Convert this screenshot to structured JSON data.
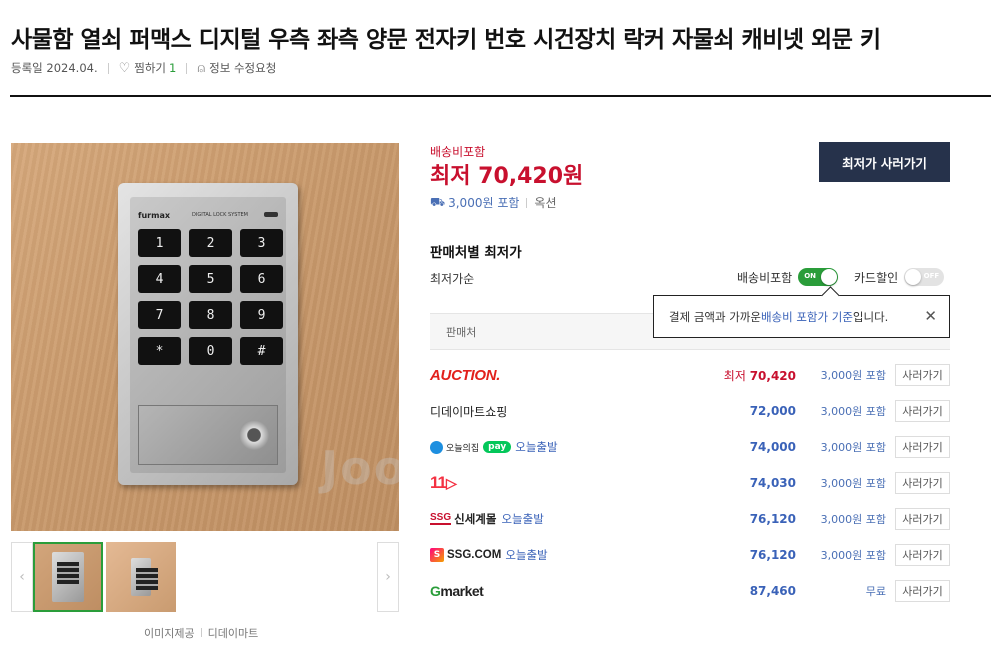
{
  "product": {
    "title": "사물함 열쇠 퍼맥스 디지털 우측 좌측 양문 전자키 번호 시건장치 락커 자물쇠 캐비넷 외문 키",
    "reg_date": "등록일 2024.04.",
    "wish_label": "찜하기",
    "wish_count": "1",
    "edit_request": "정보 수정요청"
  },
  "image": {
    "keypad_brand": "furmax",
    "keypad_system": "DIGITAL LOCK SYSTEM",
    "keys": [
      "1",
      "2",
      "3",
      "4",
      "5",
      "6",
      "7",
      "8",
      "9",
      "*",
      "0",
      "#"
    ],
    "watermark": "Joonggonara",
    "credit_label": "이미지제공",
    "credit_seller": "디데이마트"
  },
  "pricing": {
    "shipping_included": "배송비포함",
    "lowest_label": "최저",
    "lowest_price": "70,420원",
    "shipping_fee": "3,000원 포함",
    "option_label": "옥션",
    "buy_button": "최저가 사러가기"
  },
  "seller_section": {
    "title": "판매처별 최저가",
    "sort": "최저가순",
    "toggle_shipping": {
      "label": "배송비포함",
      "state": "ON"
    },
    "toggle_card": {
      "label": "카드할인",
      "state": "OFF"
    },
    "tooltip_prefix": "결제 금액과 가까운 ",
    "tooltip_highlight": "배송비 포함가 기준",
    "tooltip_suffix": "입니다.",
    "table_header": "판매처",
    "rows": [
      {
        "seller": "AUCTION.",
        "price_prefix": "최저 ",
        "price": "70,420",
        "shipping": "3,000원 포함",
        "action": "사러가기"
      },
      {
        "seller": "디데이마트쇼핑",
        "price": "72,000",
        "shipping": "3,000원 포함",
        "action": "사러가기"
      },
      {
        "seller": "오늘의집",
        "pay": "pay",
        "tag": "오늘출발",
        "price": "74,000",
        "shipping": "3,000원 포함",
        "action": "사러가기"
      },
      {
        "seller": "11",
        "price": "74,030",
        "shipping": "3,000원 포함",
        "action": "사러가기"
      },
      {
        "seller": "신세계몰",
        "logo": "SSG",
        "tag": "오늘출발",
        "price": "76,120",
        "shipping": "3,000원 포함",
        "action": "사러가기"
      },
      {
        "seller": "SSG.COM",
        "logo": "S",
        "tag": "오늘출발",
        "price": "76,120",
        "shipping": "3,000원 포함",
        "action": "사러가기"
      },
      {
        "seller_g": "G",
        "seller_rest": "market",
        "price": "87,460",
        "shipping": "무료",
        "action": "사러가기"
      }
    ]
  },
  "colors": {
    "accent_red": "#c8102e",
    "link_blue": "#3a62b8",
    "toggle_green": "#2a9d3a",
    "button_navy": "#26324b"
  }
}
